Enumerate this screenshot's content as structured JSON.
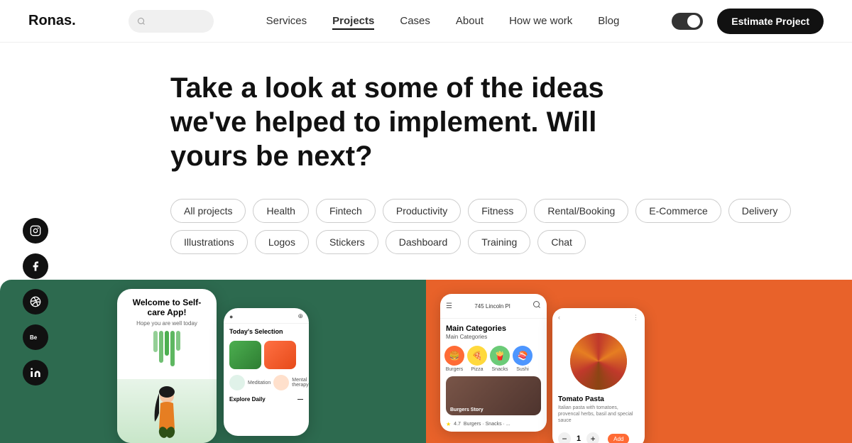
{
  "nav": {
    "logo": "Ronas.",
    "links": [
      {
        "id": "services",
        "label": "Services",
        "active": false
      },
      {
        "id": "projects",
        "label": "Projects",
        "active": true
      },
      {
        "id": "cases",
        "label": "Cases",
        "active": false
      },
      {
        "id": "about",
        "label": "About",
        "active": false
      },
      {
        "id": "how-we-work",
        "label": "How we work",
        "active": false
      },
      {
        "id": "blog",
        "label": "Blog",
        "active": false
      }
    ],
    "cta": "Estimate Project"
  },
  "hero": {
    "heading": "Take a look at some of the ideas we've helped to implement. Will yours be next?"
  },
  "filters": [
    {
      "id": "all",
      "label": "All projects"
    },
    {
      "id": "health",
      "label": "Health"
    },
    {
      "id": "fintech",
      "label": "Fintech"
    },
    {
      "id": "productivity",
      "label": "Productivity"
    },
    {
      "id": "fitness",
      "label": "Fitness"
    },
    {
      "id": "rental",
      "label": "Rental/Booking"
    },
    {
      "id": "ecommerce",
      "label": "E-Commerce"
    },
    {
      "id": "delivery",
      "label": "Delivery"
    },
    {
      "id": "illustrations",
      "label": "Illustrations"
    },
    {
      "id": "logos",
      "label": "Logos"
    },
    {
      "id": "stickers",
      "label": "Stickers"
    },
    {
      "id": "dashboard",
      "label": "Dashboard"
    },
    {
      "id": "training",
      "label": "Training"
    },
    {
      "id": "chat",
      "label": "Chat"
    }
  ],
  "cards": {
    "green": {
      "phone1": {
        "title": "Welcome to Self-care App!",
        "subtitle": "Hope you are well today"
      },
      "phone2": {
        "section": "Today's Selection",
        "explore": "Explore Daily",
        "meditation": "Meditation",
        "mental": "Mental therapy"
      }
    },
    "orange": {
      "phone1": {
        "location": "745 Lincoln Pl",
        "title": "Main Categories",
        "subtitle": "Burgers Story",
        "rating": "4.7",
        "category_label": "Burgers · Snacks · ..."
      },
      "phone2": {
        "title": "Tomato Pasta",
        "desc": "Italian pasta with tomatoes, provencal herbs, basil and special sauce",
        "qty": "1"
      }
    }
  },
  "social": [
    {
      "id": "instagram",
      "icon": "IG"
    },
    {
      "id": "facebook",
      "icon": "f"
    },
    {
      "id": "dribbble",
      "icon": "⊙"
    },
    {
      "id": "behance",
      "icon": "Be"
    },
    {
      "id": "linkedin",
      "icon": "in"
    }
  ]
}
